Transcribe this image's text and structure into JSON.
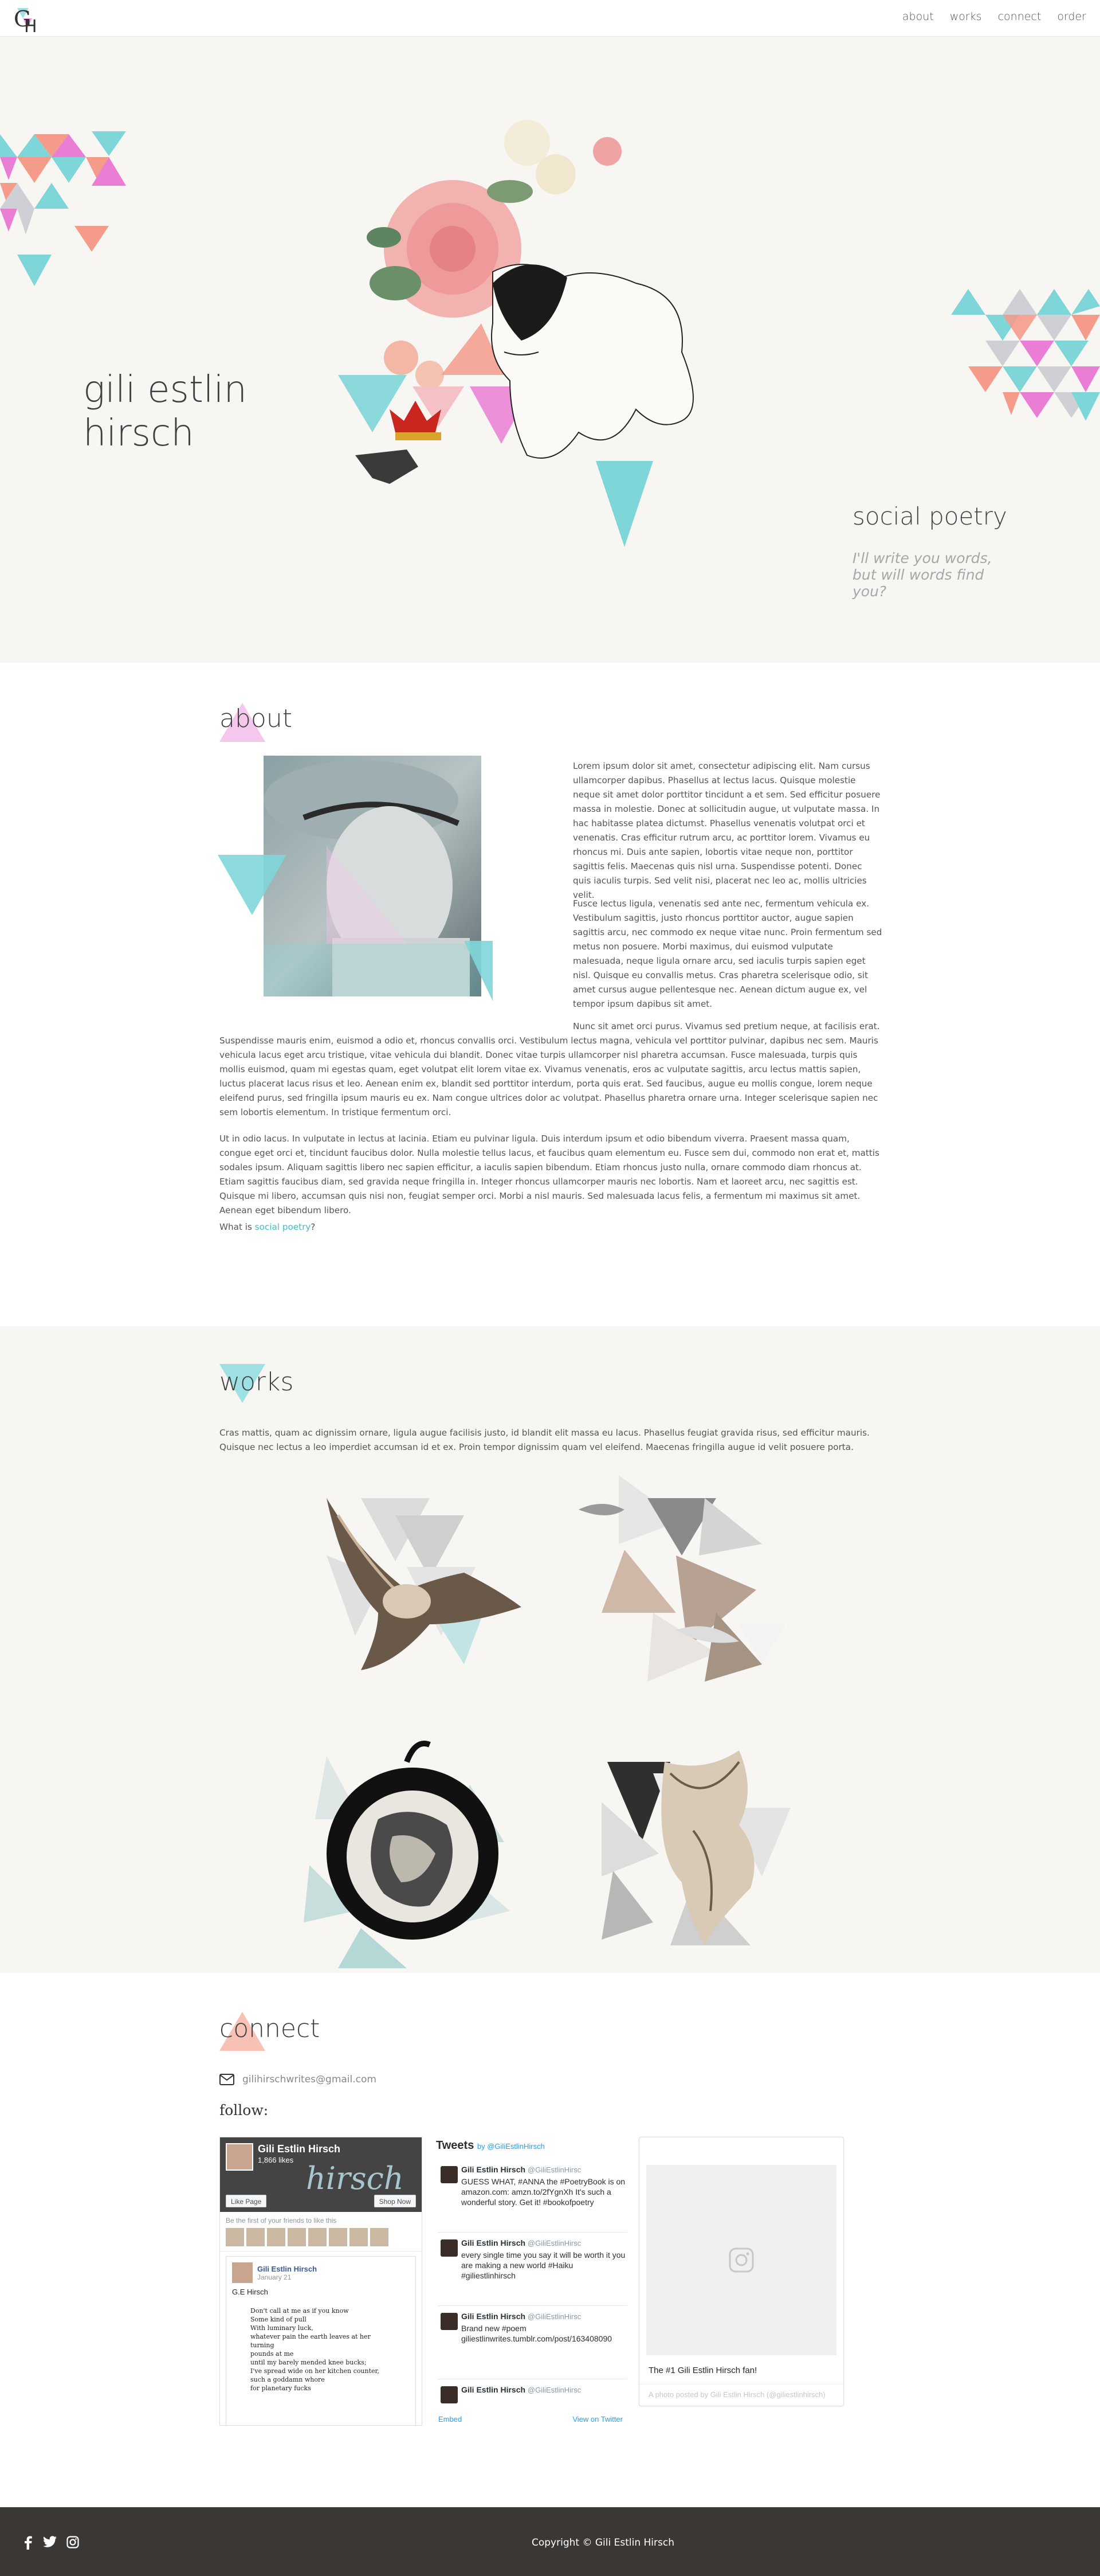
{
  "nav": {
    "logo_text": "GH",
    "items": [
      {
        "label": "about"
      },
      {
        "label": "works"
      },
      {
        "label": "connect"
      },
      {
        "label": "order"
      }
    ]
  },
  "hero": {
    "name_line1": "gili estlin",
    "name_line2": "hirsch",
    "tagline": "social poetry",
    "subtagline": "I'll write you words, but will words find you?"
  },
  "about": {
    "title": "about",
    "p1": "Lorem ipsum dolor sit amet, consectetur adipiscing elit. Nam cursus ullamcorper dapibus. Phasellus at lectus lacus. Quisque molestie neque sit amet dolor porttitor tincidunt a et sem. Sed efficitur posuere massa in molestie. Donec at sollicitudin augue, ut vulputate massa. In hac habitasse platea dictumst. Phasellus venenatis volutpat orci et venenatis. Cras efficitur rutrum arcu, ac porttitor lorem. Vivamus eu rhoncus mi. Duis ante sapien, lobortis vitae neque non, porttitor sagittis felis. Maecenas quis nisl urna. Suspendisse potenti. Donec quis iaculis turpis. Sed velit nisi, placerat nec leo ac, mollis ultricies velit.",
    "p2": "Fusce lectus ligula, venenatis sed ante nec, fermentum vehicula ex. Vestibulum sagittis, justo rhoncus porttitor auctor, augue sapien sagittis arcu, nec commodo ex neque vitae nunc. Proin fermentum sed metus non posuere. Morbi maximus, dui euismod vulputate malesuada, neque ligula ornare arcu, sed iaculis turpis sapien eget nisl. Quisque eu convallis metus. Cras pharetra scelerisque odio, sit amet cursus augue pellentesque nec. Aenean dictum augue ex, vel tempor ipsum dapibus sit amet.",
    "p3": "Nunc sit amet orci purus. Vivamus sed pretium neque, at facilisis erat. Suspendisse mauris enim, euismod a odio et, rhoncus convallis orci. Vestibulum lectus magna, vehicula vel porttitor pulvinar, dapibus nec sem. Mauris vehicula lacus eget arcu tristique, vitae vehicula dui blandit. Donec vitae turpis ullamcorper nisl pharetra accumsan. Fusce malesuada, turpis quis mollis euismod, quam mi egestas quam, eget volutpat elit lorem vitae ex. Vivamus venenatis, eros ac vulputate sagittis, arcu lectus mattis sapien, luctus placerat lacus risus et leo. Aenean enim ex, blandit sed porttitor interdum, porta quis erat. Sed faucibus, augue eu mollis congue, lorem neque eleifend purus, sed fringilla ipsum mauris eu ex. Nam congue ultrices dolor ac volutpat. Phasellus pharetra ornare urna. Integer scelerisque sapien nec sem lobortis elementum. In tristique fermentum orci.",
    "p4": "Ut in odio lacus. In vulputate in lectus at lacinia. Etiam eu pulvinar ligula. Duis interdum ipsum et odio bibendum viverra. Praesent massa quam, congue eget orci et, tincidunt faucibus dolor. Nulla molestie tellus lacus, et faucibus quam elementum eu. Fusce sem dui, commodo non erat et, mattis sodales ipsum. Aliquam sagittis libero nec sapien efficitur, a iaculis sapien bibendum. Etiam rhoncus justo nulla, ornare commodo diam rhoncus at. Etiam sagittis faucibus diam, sed gravida neque fringilla in. Integer rhoncus ullamcorper mauris nec lobortis. Nam et laoreet arcu, nec sagittis est. Quisque mi libero, accumsan quis nisi non, feugiat semper orci. Morbi a nisl mauris. Sed malesuada lacus felis, a fermentum mi maximus sit amet. Aenean eget bibendum libero.",
    "what_is_prefix": "What is ",
    "what_is_link": "social poetry",
    "what_is_suffix": "?"
  },
  "works": {
    "title": "works",
    "description": "Cras mattis, quam ac dignissim ornare, ligula augue facilisis justo, id blandit elit massa eu lacus. Phasellus feugiat gravida risus, sed efficitur mauris. Quisque nec lectus a leo imperdiet accumsan id et ex. Proin tempor dignissim quam vel eleifend. Maecenas fringilla augue id velit posuere porta."
  },
  "connect": {
    "title": "connect",
    "email": "gilihirschwrites@gmail.com",
    "follow_label": "follow:",
    "facebook": {
      "page_name": "Gili Estlin Hirsch",
      "likes": "1,866 likes",
      "cover_script": "hirsch",
      "like_button": "Like Page",
      "shop_button": "Shop Now",
      "friends_text": "Be the first of your friends to like this",
      "post_author": "Gili Estlin Hirsch",
      "post_date": "January 21",
      "post_text": "G.E Hirsch",
      "poem": [
        "Don't call at me as if you know",
        "Some kind of pull",
        "With luminary luck,",
        "whatever pain the earth leaves at her turning",
        "pounds at me",
        "until my barely mended knee bucks;",
        "I've spread wide on her kitchen counter,",
        "such a goddamn whore",
        "for planetary fucks"
      ]
    },
    "twitter": {
      "header": "Tweets",
      "by": "by @GiliEstlinHirsch",
      "tweets": [
        {
          "name": "Gili Estlin Hirsch",
          "handle": "@GiliEstlinHirsc",
          "text": "GUESS WHAT, #ANNA the #PoetryBook is on amazon.com: amzn.to/2fYgnXh It's such a wonderful story. Get it! #bookofpoetry"
        },
        {
          "name": "Gili Estlin Hirsch",
          "handle": "@GiliEstlinHirsc",
          "text": "every single time you say it will be worth it you are making a new world #Haiku #giliestlinhirsch"
        },
        {
          "name": "Gili Estlin Hirsch",
          "handle": "@GiliEstlinHirsc",
          "text": "Brand new #poem giliestlinwrites.tumblr.com/post/163408090"
        },
        {
          "name": "Gili Estlin Hirsch",
          "handle": "@GiliEstlinHirsc",
          "text": ""
        }
      ],
      "embed": "Embed",
      "view": "View on Twitter"
    },
    "instagram": {
      "caption": "The #1 Gili Estlin Hirsch fan!",
      "by": "A photo posted by Gili Estlin Hirsch (@giliestlinhirsch)"
    }
  },
  "footer": {
    "copyright": "Copyright © Gili Estlin Hirsch"
  },
  "colors": {
    "teal": "#7fd6d9",
    "pink": "#ea7ed4",
    "coral": "#f59b8a",
    "grey": "#cfd0d6",
    "link": "#3fc0c6",
    "footer_bg": "#3b3735"
  }
}
